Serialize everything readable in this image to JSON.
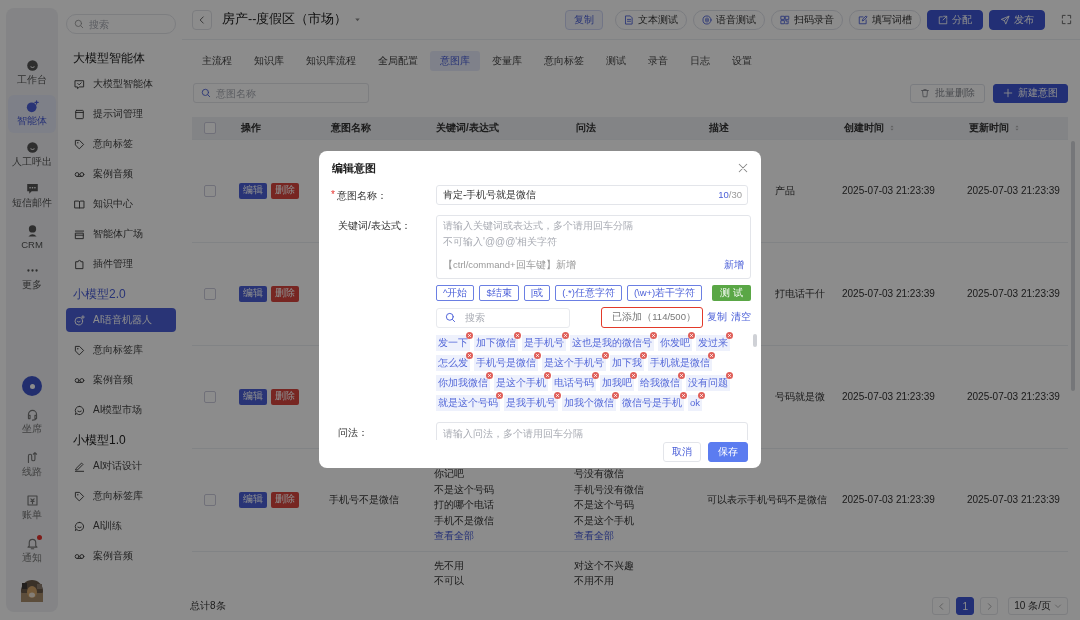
{
  "rail": {
    "items": [
      {
        "label": "工作台",
        "selected": false
      },
      {
        "label": "智能体",
        "selected": true
      },
      {
        "label": "人工呼出",
        "selected": false
      },
      {
        "label": "短信邮件",
        "selected": false
      },
      {
        "label": "CRM",
        "selected": false
      },
      {
        "label": "更多",
        "selected": false
      }
    ],
    "bottom_items": [
      {
        "label": "坐席",
        "unread": false
      },
      {
        "label": "线路",
        "unread": false
      },
      {
        "label": "账单",
        "unread": false
      },
      {
        "label": "通知",
        "unread": true
      }
    ]
  },
  "sidebar": {
    "search": {
      "placeholder": "搜索"
    },
    "groups": [
      {
        "title": "大模型智能体",
        "highlight": false,
        "items": [
          {
            "label": "大模型智能体",
            "selected": false
          },
          {
            "label": "提示词管理",
            "selected": false
          },
          {
            "label": "意向标签",
            "selected": false
          },
          {
            "label": "案例音频",
            "selected": false
          },
          {
            "label": "知识中心",
            "selected": false
          },
          {
            "label": "智能体广场",
            "selected": false
          },
          {
            "label": "插件管理",
            "selected": false
          }
        ]
      },
      {
        "title": "小模型2.0",
        "highlight": true,
        "items": [
          {
            "label": "AI语音机器人",
            "selected": true
          },
          {
            "label": "意向标签库",
            "selected": false
          },
          {
            "label": "案例音频",
            "selected": false
          },
          {
            "label": "AI模型市场",
            "selected": false
          }
        ]
      },
      {
        "title": "小模型1.0",
        "highlight": false,
        "items": [
          {
            "label": "AI对话设计",
            "selected": false
          },
          {
            "label": "意向标签库",
            "selected": false
          },
          {
            "label": "AI训练",
            "selected": false
          },
          {
            "label": "案例音频",
            "selected": false
          }
        ]
      }
    ]
  },
  "topbar": {
    "title": "房产--度假区（市场）",
    "actions": [
      {
        "label": "复制",
        "kind": "plain"
      },
      {
        "label": "文本测试",
        "kind": "outline"
      },
      {
        "label": "语音测试",
        "kind": "outline"
      },
      {
        "label": "扫码录音",
        "kind": "outline"
      },
      {
        "label": "填写词槽",
        "kind": "outline"
      },
      {
        "label": "分配",
        "kind": "primary"
      },
      {
        "label": "发布",
        "kind": "primary"
      }
    ]
  },
  "tabs": [
    {
      "label": "主流程",
      "selected": false
    },
    {
      "label": "知识库",
      "selected": false
    },
    {
      "label": "知识库流程",
      "selected": false
    },
    {
      "label": "全局配置",
      "selected": false
    },
    {
      "label": "意图库",
      "selected": true
    },
    {
      "label": "变量库",
      "selected": false
    },
    {
      "label": "意向标签",
      "selected": false
    },
    {
      "label": "测试",
      "selected": false
    },
    {
      "label": "录音",
      "selected": false
    },
    {
      "label": "日志",
      "selected": false
    },
    {
      "label": "设置",
      "selected": false
    }
  ],
  "toolbar": {
    "search": {
      "placeholder": "意图名称"
    },
    "buttons": [
      {
        "label": "批量删除",
        "kind": "outline",
        "disabled": true
      },
      {
        "label": "新建意图",
        "kind": "primary",
        "disabled": false
      }
    ]
  },
  "table": {
    "select_all": {
      "checked": false
    },
    "columns": [
      {
        "label": "操作",
        "sortable": false
      },
      {
        "label": "意图名称",
        "sortable": false
      },
      {
        "label": "关键词/表达式",
        "sortable": false
      },
      {
        "label": "问法",
        "sortable": false
      },
      {
        "label": "描述",
        "sortable": false
      },
      {
        "label": "创建时间",
        "sortable": true
      },
      {
        "label": "更新时间",
        "sortable": true
      }
    ],
    "rows": [
      {
        "kind": "covered",
        "checked": false,
        "actions": [
          "编辑",
          "删除"
        ],
        "description": "产品",
        "created": "2025-07-03 21:23:39",
        "updated": "2025-07-03 21:23:39"
      },
      {
        "kind": "covered",
        "checked": false,
        "actions": [
          "编辑",
          "删除"
        ],
        "description": "打电话干什",
        "created": "2025-07-03 21:23:39",
        "updated": "2025-07-03 21:23:39"
      },
      {
        "kind": "covered",
        "checked": false,
        "actions": [
          "编辑",
          "删除"
        ],
        "description": "号码就是微",
        "created": "2025-07-03 21:23:39",
        "updated": "2025-07-03 21:23:39"
      },
      {
        "kind": "open",
        "checked": false,
        "actions": [
          "编辑",
          "删除"
        ],
        "name": "手机号不是微信",
        "keywords": [
          "你记吧",
          "不是这个号码",
          "打的哪个电话",
          "手机不是微信"
        ],
        "keywords_more": "查看全部",
        "phrasings": [
          "号没有微信",
          "手机号没有微信",
          "不是这个号码",
          "不是这个手机"
        ],
        "phrasings_more": "查看全部",
        "description": "可以表示手机号码不是微信",
        "created": "2025-07-03 21:23:39",
        "updated": "2025-07-03 21:23:39"
      },
      {
        "kind": "clipped",
        "keywords": [
          "先不用",
          "不可以"
        ],
        "phrasings": [
          "对这个不兴趣",
          "不用不用"
        ]
      }
    ]
  },
  "footer": {
    "total": "总计8条",
    "pages": [
      {
        "label": "1",
        "selected": true
      }
    ],
    "page_size": "10 条/页"
  },
  "modal": {
    "title": "编辑意图",
    "name_field": {
      "required_mark": "*",
      "label": "意图名称：",
      "value": "肯定-手机号就是微信",
      "count": "10",
      "max": "/30"
    },
    "keyword_field": {
      "label": "关键词/表达式：",
      "placeholder": "请输入关键词或表达式，多个请用回车分隔",
      "note": "不可输入'@@@'相关字符",
      "hint": "【ctrl/command+回车键】新增",
      "add_link": "新增"
    },
    "regex_buttons": [
      "^开始",
      "$结束",
      "|或",
      "(.*)任意字符",
      "(\\w+)若干字符"
    ],
    "test_button": "测 试",
    "tag_search": {
      "placeholder": "搜索"
    },
    "added_count": {
      "text": "已添加（114/500）",
      "highlighted": true
    },
    "copy_link": "复制",
    "clear_link": "清空",
    "tags": [
      "发一下",
      "加下微信",
      "是手机号",
      "这也是我的微信号",
      "你发吧",
      "发过来",
      "怎么发",
      "手机号是微信",
      "是这个手机号",
      "加下我",
      "手机就是微信",
      "你加我微信",
      "是这个手机",
      "电话号码",
      "加我吧",
      "给我微信",
      "没有问题",
      "就是这个号码",
      "是我手机号",
      "加我个微信",
      "微信号是手机",
      "ok"
    ],
    "phrasing_field": {
      "label": "问法：",
      "placeholder": "请输入问法，多个请用回车分隔"
    },
    "buttons": [
      {
        "label": "取消",
        "kind": "default"
      },
      {
        "label": "保存",
        "kind": "primary"
      }
    ]
  }
}
